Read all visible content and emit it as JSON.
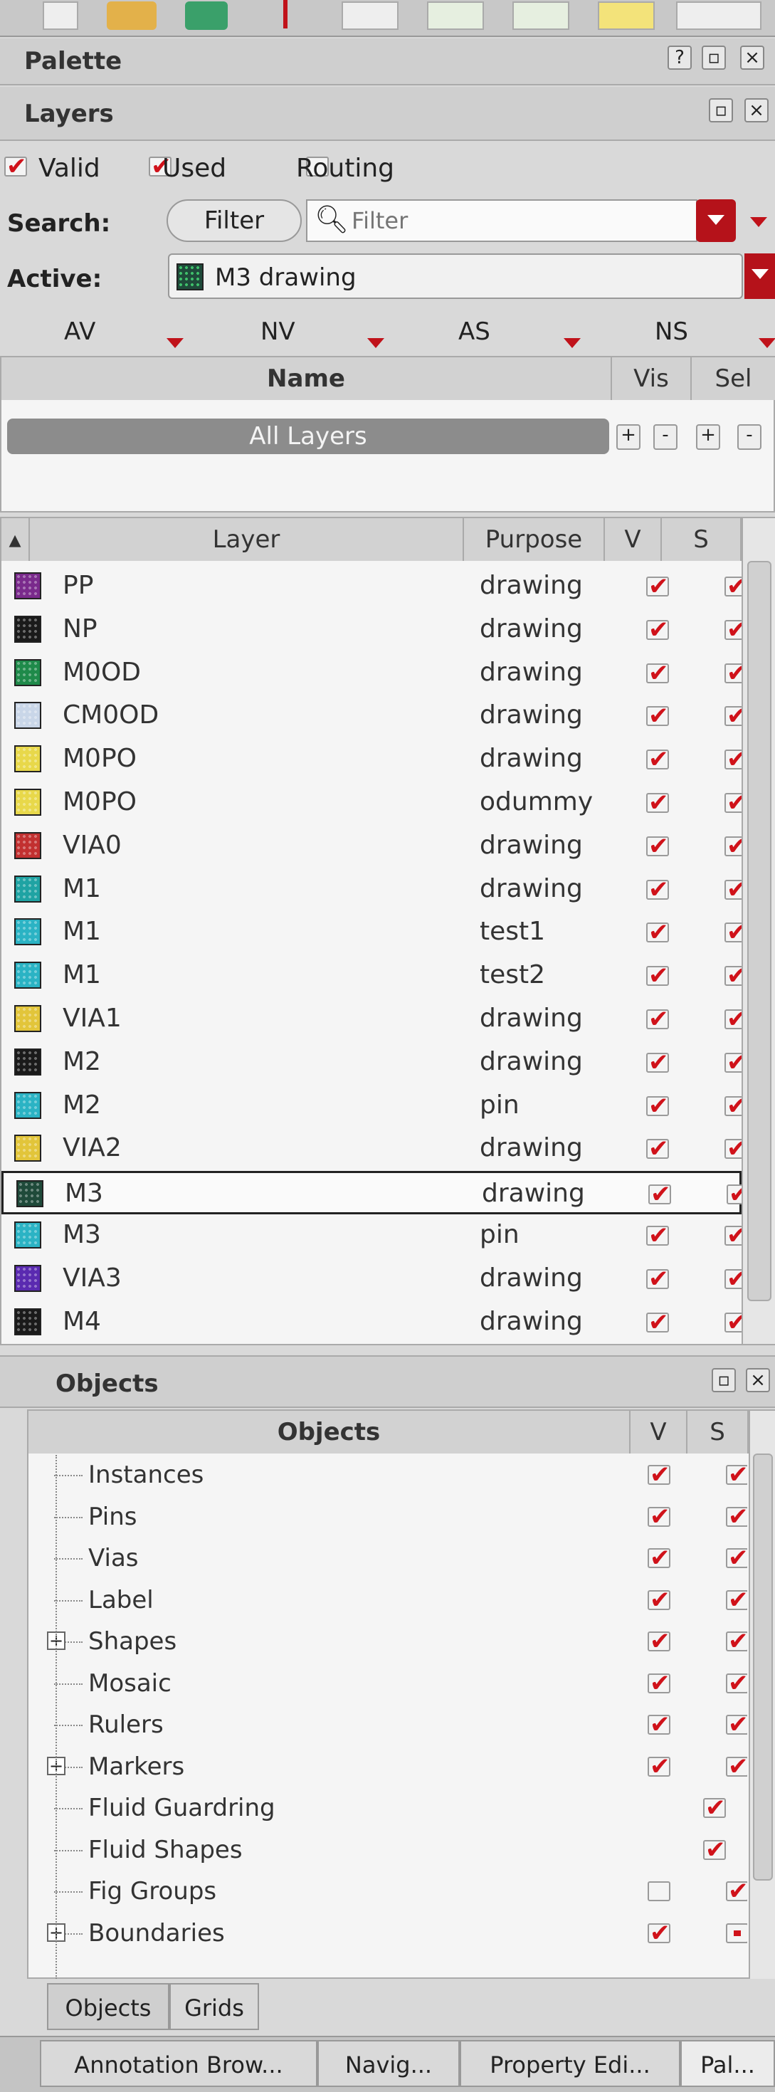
{
  "palette": {
    "title": "Palette",
    "help_icon": "?",
    "restore_icon": "restore-icon",
    "close_icon": "×"
  },
  "layers_panel": {
    "title": "Layers",
    "filters": {
      "valid_label": "Valid",
      "used_label": "Used",
      "routing_label": "Routing",
      "valid": true,
      "used": true,
      "routing": false
    },
    "search": {
      "label": "Search:",
      "filter_button": "Filter",
      "placeholder": "Filter"
    },
    "active": {
      "label": "Active:",
      "value": "M3 drawing"
    },
    "visibility_columns": [
      "AV",
      "NV",
      "AS",
      "NS"
    ],
    "name_table": {
      "name_header": "Name",
      "vis_header": "Vis",
      "sel_header": "Sel",
      "all_layers": "All Layers"
    },
    "layer_table": {
      "headers": {
        "layer": "Layer",
        "purpose": "Purpose",
        "v": "V",
        "s": "S"
      },
      "rows": [
        {
          "layer": "PP",
          "purpose": "drawing",
          "v": true,
          "s": true,
          "swatch": "#7a2a8c"
        },
        {
          "layer": "NP",
          "purpose": "drawing",
          "v": true,
          "s": true,
          "swatch": "#1a1a1a"
        },
        {
          "layer": "M0OD",
          "purpose": "drawing",
          "v": true,
          "s": true,
          "swatch": "#1f8a4a"
        },
        {
          "layer": "CM0OD",
          "purpose": "drawing",
          "v": true,
          "s": true,
          "swatch": "#c9d6e8"
        },
        {
          "layer": "M0PO",
          "purpose": "drawing",
          "v": true,
          "s": true,
          "swatch": "#e8d84a"
        },
        {
          "layer": "M0PO",
          "purpose": "odummy",
          "v": true,
          "s": true,
          "swatch": "#e8d84a"
        },
        {
          "layer": "VIA0",
          "purpose": "drawing",
          "v": true,
          "s": true,
          "swatch": "#c23030"
        },
        {
          "layer": "M1",
          "purpose": "drawing",
          "v": true,
          "s": true,
          "swatch": "#1fa3a3"
        },
        {
          "layer": "M1",
          "purpose": "test1",
          "v": true,
          "s": true,
          "swatch": "#2bb3c4"
        },
        {
          "layer": "M1",
          "purpose": "test2",
          "v": true,
          "s": true,
          "swatch": "#2bb3c4"
        },
        {
          "layer": "VIA1",
          "purpose": "drawing",
          "v": true,
          "s": true,
          "swatch": "#e2c53a"
        },
        {
          "layer": "M2",
          "purpose": "drawing",
          "v": true,
          "s": true,
          "swatch": "#1a1a1a"
        },
        {
          "layer": "M2",
          "purpose": "pin",
          "v": true,
          "s": true,
          "swatch": "#2bb3c4"
        },
        {
          "layer": "VIA2",
          "purpose": "drawing",
          "v": true,
          "s": true,
          "swatch": "#e2c53a"
        },
        {
          "layer": "M3",
          "purpose": "drawing",
          "v": true,
          "s": true,
          "swatch": "#1f4a3a",
          "selected": true
        },
        {
          "layer": "M3",
          "purpose": "pin",
          "v": true,
          "s": true,
          "swatch": "#2bb3c4"
        },
        {
          "layer": "VIA3",
          "purpose": "drawing",
          "v": true,
          "s": true,
          "swatch": "#5a2ab0"
        },
        {
          "layer": "M4",
          "purpose": "drawing",
          "v": true,
          "s": true,
          "swatch": "#1a1a1a"
        }
      ]
    }
  },
  "objects_panel": {
    "title": "Objects",
    "headers": {
      "objects": "Objects",
      "v": "V",
      "s": "S"
    },
    "rows": [
      {
        "label": "Instances",
        "expandable": false,
        "v": "on",
        "s": "on"
      },
      {
        "label": "Pins",
        "expandable": false,
        "v": "on",
        "s": "on"
      },
      {
        "label": "Vias",
        "expandable": false,
        "v": "on",
        "s": "on"
      },
      {
        "label": "Label",
        "expandable": false,
        "v": "on",
        "s": "on"
      },
      {
        "label": "Shapes",
        "expandable": true,
        "v": "on",
        "s": "on"
      },
      {
        "label": "Mosaic",
        "expandable": false,
        "v": "on",
        "s": "on"
      },
      {
        "label": "Rulers",
        "expandable": false,
        "v": "on",
        "s": "on"
      },
      {
        "label": "Markers",
        "expandable": true,
        "v": "on",
        "s": "on"
      },
      {
        "label": "Fluid Guardring",
        "expandable": false,
        "v": "none",
        "s": "on"
      },
      {
        "label": "Fluid Shapes",
        "expandable": false,
        "v": "none",
        "s": "on"
      },
      {
        "label": "Fig Groups",
        "expandable": false,
        "v": "off",
        "s": "on"
      },
      {
        "label": "Boundaries",
        "expandable": true,
        "v": "on",
        "s": "partial"
      }
    ],
    "tabs": [
      "Objects",
      "Grids"
    ]
  },
  "bottom_tabs": [
    "Annotation Brow...",
    "Navig...",
    "Property Edi...",
    "Pal..."
  ]
}
